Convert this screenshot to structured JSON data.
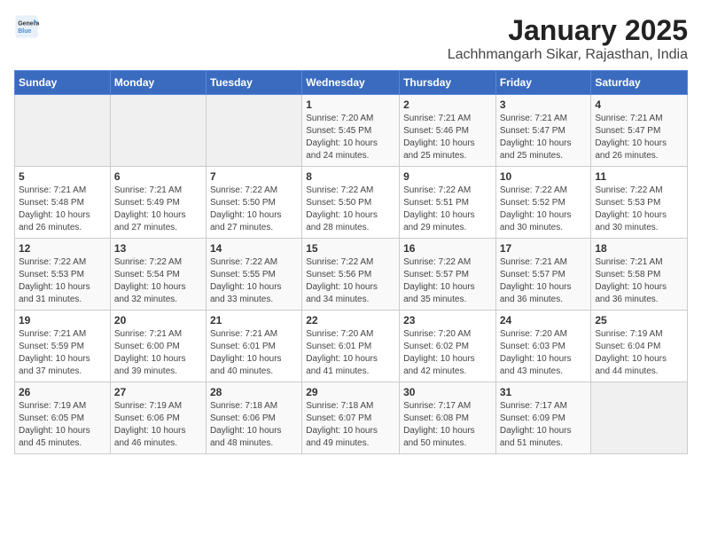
{
  "logo": {
    "line1": "General",
    "line2": "Blue"
  },
  "title": "January 2025",
  "subtitle": "Lachhmangarh Sikar, Rajasthan, India",
  "days_of_week": [
    "Sunday",
    "Monday",
    "Tuesday",
    "Wednesday",
    "Thursday",
    "Friday",
    "Saturday"
  ],
  "weeks": [
    [
      {
        "num": "",
        "info": ""
      },
      {
        "num": "",
        "info": ""
      },
      {
        "num": "",
        "info": ""
      },
      {
        "num": "1",
        "info": "Sunrise: 7:20 AM\nSunset: 5:45 PM\nDaylight: 10 hours\nand 24 minutes."
      },
      {
        "num": "2",
        "info": "Sunrise: 7:21 AM\nSunset: 5:46 PM\nDaylight: 10 hours\nand 25 minutes."
      },
      {
        "num": "3",
        "info": "Sunrise: 7:21 AM\nSunset: 5:47 PM\nDaylight: 10 hours\nand 25 minutes."
      },
      {
        "num": "4",
        "info": "Sunrise: 7:21 AM\nSunset: 5:47 PM\nDaylight: 10 hours\nand 26 minutes."
      }
    ],
    [
      {
        "num": "5",
        "info": "Sunrise: 7:21 AM\nSunset: 5:48 PM\nDaylight: 10 hours\nand 26 minutes."
      },
      {
        "num": "6",
        "info": "Sunrise: 7:21 AM\nSunset: 5:49 PM\nDaylight: 10 hours\nand 27 minutes."
      },
      {
        "num": "7",
        "info": "Sunrise: 7:22 AM\nSunset: 5:50 PM\nDaylight: 10 hours\nand 27 minutes."
      },
      {
        "num": "8",
        "info": "Sunrise: 7:22 AM\nSunset: 5:50 PM\nDaylight: 10 hours\nand 28 minutes."
      },
      {
        "num": "9",
        "info": "Sunrise: 7:22 AM\nSunset: 5:51 PM\nDaylight: 10 hours\nand 29 minutes."
      },
      {
        "num": "10",
        "info": "Sunrise: 7:22 AM\nSunset: 5:52 PM\nDaylight: 10 hours\nand 30 minutes."
      },
      {
        "num": "11",
        "info": "Sunrise: 7:22 AM\nSunset: 5:53 PM\nDaylight: 10 hours\nand 30 minutes."
      }
    ],
    [
      {
        "num": "12",
        "info": "Sunrise: 7:22 AM\nSunset: 5:53 PM\nDaylight: 10 hours\nand 31 minutes."
      },
      {
        "num": "13",
        "info": "Sunrise: 7:22 AM\nSunset: 5:54 PM\nDaylight: 10 hours\nand 32 minutes."
      },
      {
        "num": "14",
        "info": "Sunrise: 7:22 AM\nSunset: 5:55 PM\nDaylight: 10 hours\nand 33 minutes."
      },
      {
        "num": "15",
        "info": "Sunrise: 7:22 AM\nSunset: 5:56 PM\nDaylight: 10 hours\nand 34 minutes."
      },
      {
        "num": "16",
        "info": "Sunrise: 7:22 AM\nSunset: 5:57 PM\nDaylight: 10 hours\nand 35 minutes."
      },
      {
        "num": "17",
        "info": "Sunrise: 7:21 AM\nSunset: 5:57 PM\nDaylight: 10 hours\nand 36 minutes."
      },
      {
        "num": "18",
        "info": "Sunrise: 7:21 AM\nSunset: 5:58 PM\nDaylight: 10 hours\nand 36 minutes."
      }
    ],
    [
      {
        "num": "19",
        "info": "Sunrise: 7:21 AM\nSunset: 5:59 PM\nDaylight: 10 hours\nand 37 minutes."
      },
      {
        "num": "20",
        "info": "Sunrise: 7:21 AM\nSunset: 6:00 PM\nDaylight: 10 hours\nand 39 minutes."
      },
      {
        "num": "21",
        "info": "Sunrise: 7:21 AM\nSunset: 6:01 PM\nDaylight: 10 hours\nand 40 minutes."
      },
      {
        "num": "22",
        "info": "Sunrise: 7:20 AM\nSunset: 6:01 PM\nDaylight: 10 hours\nand 41 minutes."
      },
      {
        "num": "23",
        "info": "Sunrise: 7:20 AM\nSunset: 6:02 PM\nDaylight: 10 hours\nand 42 minutes."
      },
      {
        "num": "24",
        "info": "Sunrise: 7:20 AM\nSunset: 6:03 PM\nDaylight: 10 hours\nand 43 minutes."
      },
      {
        "num": "25",
        "info": "Sunrise: 7:19 AM\nSunset: 6:04 PM\nDaylight: 10 hours\nand 44 minutes."
      }
    ],
    [
      {
        "num": "26",
        "info": "Sunrise: 7:19 AM\nSunset: 6:05 PM\nDaylight: 10 hours\nand 45 minutes."
      },
      {
        "num": "27",
        "info": "Sunrise: 7:19 AM\nSunset: 6:06 PM\nDaylight: 10 hours\nand 46 minutes."
      },
      {
        "num": "28",
        "info": "Sunrise: 7:18 AM\nSunset: 6:06 PM\nDaylight: 10 hours\nand 48 minutes."
      },
      {
        "num": "29",
        "info": "Sunrise: 7:18 AM\nSunset: 6:07 PM\nDaylight: 10 hours\nand 49 minutes."
      },
      {
        "num": "30",
        "info": "Sunrise: 7:17 AM\nSunset: 6:08 PM\nDaylight: 10 hours\nand 50 minutes."
      },
      {
        "num": "31",
        "info": "Sunrise: 7:17 AM\nSunset: 6:09 PM\nDaylight: 10 hours\nand 51 minutes."
      },
      {
        "num": "",
        "info": ""
      }
    ]
  ]
}
